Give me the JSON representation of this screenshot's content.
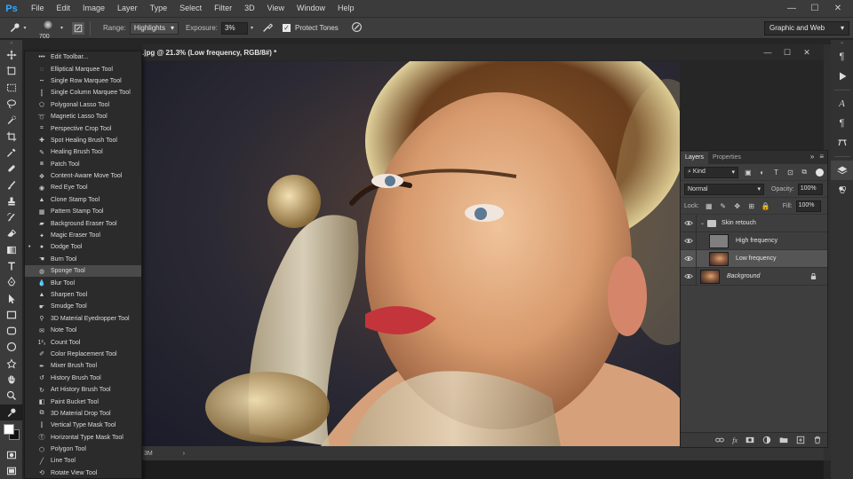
{
  "menu": {
    "logo": "Ps",
    "items": [
      "File",
      "Edit",
      "Image",
      "Layer",
      "Type",
      "Select",
      "Filter",
      "3D",
      "View",
      "Window",
      "Help"
    ],
    "window_controls": [
      "—",
      "☐",
      "✕"
    ]
  },
  "options": {
    "brush_size": "700",
    "range_label": "Range:",
    "range_value": "Highlights",
    "exposure_label": "Exposure:",
    "exposure_value": "3%",
    "protect_tones_label": "Protect Tones",
    "protect_tones_checked": true,
    "workspace": "Graphic and Web"
  },
  "tool_menu": {
    "highlighted_index": 18,
    "items": [
      {
        "label": "Edit Toolbar...",
        "icon": "more-icon"
      },
      {
        "label": "Elliptical Marquee Tool",
        "icon": "elliptical-marquee-icon"
      },
      {
        "label": "Single Row Marquee Tool",
        "icon": "single-row-marquee-icon"
      },
      {
        "label": "Single Column Marquee Tool",
        "icon": "single-column-marquee-icon"
      },
      {
        "label": "Polygonal Lasso Tool",
        "icon": "polygonal-lasso-icon"
      },
      {
        "label": "Magnetic Lasso Tool",
        "icon": "magnetic-lasso-icon"
      },
      {
        "label": "Perspective Crop Tool",
        "icon": "perspective-crop-icon"
      },
      {
        "label": "Spot Healing Brush Tool",
        "icon": "spot-healing-icon"
      },
      {
        "label": "Healing Brush Tool",
        "icon": "healing-brush-icon"
      },
      {
        "label": "Patch Tool",
        "icon": "patch-icon"
      },
      {
        "label": "Content-Aware Move Tool",
        "icon": "content-aware-move-icon"
      },
      {
        "label": "Red Eye Tool",
        "icon": "red-eye-icon"
      },
      {
        "label": "Clone Stamp Tool",
        "icon": "clone-stamp-icon"
      },
      {
        "label": "Pattern Stamp Tool",
        "icon": "pattern-stamp-icon"
      },
      {
        "label": "Background Eraser Tool",
        "icon": "background-eraser-icon"
      },
      {
        "label": "Magic Eraser Tool",
        "icon": "magic-eraser-icon"
      },
      {
        "label": "Dodge Tool",
        "icon": "dodge-icon",
        "bullet": true
      },
      {
        "label": "Burn Tool",
        "icon": "burn-icon"
      },
      {
        "label": "Sponge Tool",
        "icon": "sponge-icon"
      },
      {
        "label": "Blur Tool",
        "icon": "blur-icon"
      },
      {
        "label": "Sharpen Tool",
        "icon": "sharpen-icon"
      },
      {
        "label": "Smudge Tool",
        "icon": "smudge-icon"
      },
      {
        "label": "3D Material Eyedropper Tool",
        "icon": "3d-eyedropper-icon"
      },
      {
        "label": "Note Tool",
        "icon": "note-icon"
      },
      {
        "label": "Count Tool",
        "icon": "count-icon"
      },
      {
        "label": "Color Replacement Tool",
        "icon": "color-replacement-icon"
      },
      {
        "label": "Mixer Brush Tool",
        "icon": "mixer-brush-icon"
      },
      {
        "label": "History Brush Tool",
        "icon": "history-brush-icon"
      },
      {
        "label": "Art History Brush Tool",
        "icon": "art-history-brush-icon"
      },
      {
        "label": "Paint Bucket Tool",
        "icon": "paint-bucket-icon"
      },
      {
        "label": "3D Material Drop Tool",
        "icon": "3d-material-drop-icon"
      },
      {
        "label": "Vertical Type Mask Tool",
        "icon": "vertical-type-mask-icon"
      },
      {
        "label": "Horizontal Type Mask Tool",
        "icon": "horizontal-type-mask-icon"
      },
      {
        "label": "Polygon Tool",
        "icon": "polygon-icon"
      },
      {
        "label": "Line Tool",
        "icon": "line-icon"
      },
      {
        "label": "Rotate View Tool",
        "icon": "rotate-view-icon"
      }
    ]
  },
  "document": {
    "title": ".jpg @ 21.3% (Low frequency, RGB/8#) *",
    "zoom_status": "3M",
    "status_arrow": "›"
  },
  "layers_panel": {
    "tabs": [
      "Layers",
      "Properties"
    ],
    "active_tab": "Layers",
    "kind_label": "Kind",
    "blend_mode": "Normal",
    "opacity_label": "Opacity:",
    "opacity_value": "100%",
    "lock_label": "Lock:",
    "fill_label": "Fill:",
    "fill_value": "100%",
    "layers": [
      {
        "name": "Skin retouch",
        "type": "group",
        "visible": true
      },
      {
        "name": "High frequency",
        "type": "gray",
        "visible": true
      },
      {
        "name": "Low frequency",
        "type": "photo",
        "visible": true,
        "selected": true
      },
      {
        "name": "Background",
        "type": "photo",
        "visible": true,
        "locked": true,
        "italic": true
      }
    ]
  },
  "colors": {
    "app_bg": "#262626",
    "panel_bg": "#3e3e3e",
    "selected_layer": "#555555",
    "ps_blue": "#31a8ff",
    "foreground_swatch": "#ffffff",
    "background_swatch": "#111111"
  }
}
